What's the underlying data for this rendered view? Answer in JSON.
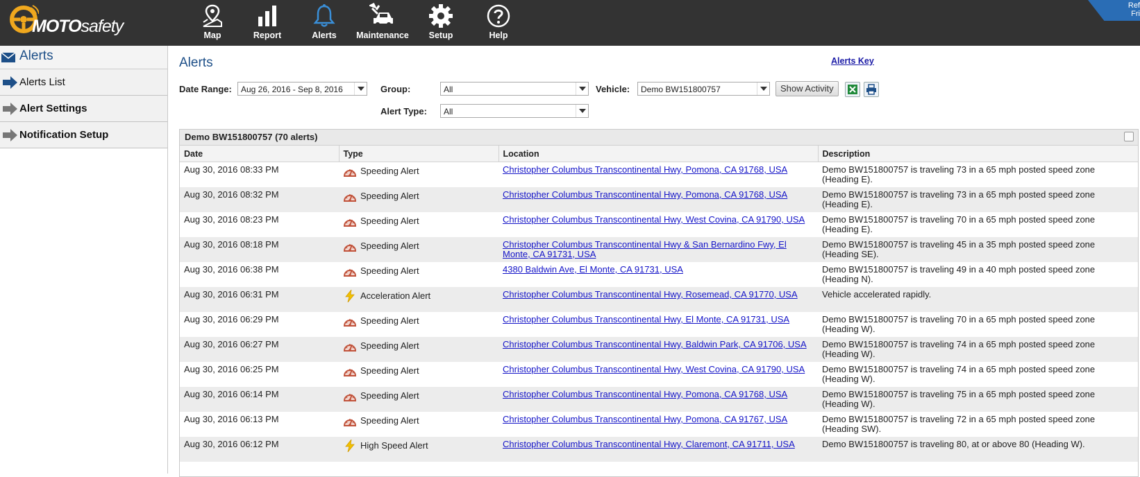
{
  "brand": {
    "logo_main": "MOTO",
    "logo_sub": "safety",
    "corner_text_1": "Ref",
    "corner_text_2": "Fri"
  },
  "nav": [
    {
      "label": "Map",
      "icon": "map-pin-icon"
    },
    {
      "label": "Report",
      "icon": "bar-chart-icon"
    },
    {
      "label": "Alerts",
      "icon": "bell-icon"
    },
    {
      "label": "Maintenance",
      "icon": "car-wrench-icon"
    },
    {
      "label": "Setup",
      "icon": "gear-icon"
    },
    {
      "label": "Help",
      "icon": "question-icon"
    }
  ],
  "sidebar": {
    "title": "Alerts",
    "items": [
      {
        "label": "Alerts List"
      },
      {
        "label": "Alert Settings"
      },
      {
        "label": "Notification Setup"
      }
    ]
  },
  "page": {
    "title": "Alerts",
    "alerts_key": "Alerts Key"
  },
  "filters": {
    "date_range_label": "Date Range:",
    "date_range_value": "Aug 26, 2016 - Sep 8, 2016",
    "group_label": "Group:",
    "group_value": "All",
    "vehicle_label": "Vehicle:",
    "vehicle_value": "Demo BW151800757",
    "show_activity": "Show Activity",
    "alert_type_label": "Alert Type:",
    "alert_type_value": "All"
  },
  "panel": {
    "title": "Demo BW151800757 (70 alerts)"
  },
  "table": {
    "headers": [
      "Date",
      "Type",
      "Location",
      "Description"
    ],
    "rows": [
      {
        "date": "Aug 30, 2016 08:33 PM",
        "type": "Speeding Alert",
        "kind": "speed",
        "location": "Christopher Columbus Transcontinental Hwy, Pomona, CA 91768, USA",
        "desc": "Demo BW151800757 is traveling 73 in a 65 mph posted speed zone (Heading E)."
      },
      {
        "date": "Aug 30, 2016 08:32 PM",
        "type": "Speeding Alert",
        "kind": "speed",
        "location": "Christopher Columbus Transcontinental Hwy, Pomona, CA 91768, USA",
        "desc": "Demo BW151800757 is traveling 73 in a 65 mph posted speed zone (Heading E)."
      },
      {
        "date": "Aug 30, 2016 08:23 PM",
        "type": "Speeding Alert",
        "kind": "speed",
        "location": "Christopher Columbus Transcontinental Hwy, West Covina, CA 91790, USA",
        "desc": "Demo BW151800757 is traveling 70 in a 65 mph posted speed zone (Heading E)."
      },
      {
        "date": "Aug 30, 2016 08:18 PM",
        "type": "Speeding Alert",
        "kind": "speed",
        "location": "Christopher Columbus Transcontinental Hwy & San Bernardino Fwy, El Monte, CA 91731, USA",
        "desc": "Demo BW151800757 is traveling 45 in a 35 mph posted speed zone (Heading SE)."
      },
      {
        "date": "Aug 30, 2016 06:38 PM",
        "type": "Speeding Alert",
        "kind": "speed",
        "location": "4380 Baldwin Ave, El Monte, CA 91731, USA",
        "desc": "Demo BW151800757 is traveling 49 in a 40 mph posted speed zone (Heading N)."
      },
      {
        "date": "Aug 30, 2016 06:31 PM",
        "type": "Acceleration Alert",
        "kind": "bolt",
        "location": "Christopher Columbus Transcontinental Hwy, Rosemead, CA 91770, USA",
        "desc": "Vehicle accelerated rapidly."
      },
      {
        "date": "Aug 30, 2016 06:29 PM",
        "type": "Speeding Alert",
        "kind": "speed",
        "location": "Christopher Columbus Transcontinental Hwy, El Monte, CA 91731, USA",
        "desc": "Demo BW151800757 is traveling 70 in a 65 mph posted speed zone (Heading W)."
      },
      {
        "date": "Aug 30, 2016 06:27 PM",
        "type": "Speeding Alert",
        "kind": "speed",
        "location": "Christopher Columbus Transcontinental Hwy, Baldwin Park, CA 91706, USA",
        "desc": "Demo BW151800757 is traveling 74 in a 65 mph posted speed zone (Heading W)."
      },
      {
        "date": "Aug 30, 2016 06:25 PM",
        "type": "Speeding Alert",
        "kind": "speed",
        "location": "Christopher Columbus Transcontinental Hwy, West Covina, CA 91790, USA",
        "desc": "Demo BW151800757 is traveling 74 in a 65 mph posted speed zone (Heading W)."
      },
      {
        "date": "Aug 30, 2016 06:14 PM",
        "type": "Speeding Alert",
        "kind": "speed",
        "location": "Christopher Columbus Transcontinental Hwy, Pomona, CA 91768, USA",
        "desc": "Demo BW151800757 is traveling 75 in a 65 mph posted speed zone (Heading W)."
      },
      {
        "date": "Aug 30, 2016 06:13 PM",
        "type": "Speeding Alert",
        "kind": "speed",
        "location": "Christopher Columbus Transcontinental Hwy, Pomona, CA 91767, USA",
        "desc": "Demo BW151800757 is traveling 72 in a 65 mph posted speed zone (Heading SW)."
      },
      {
        "date": "Aug 30, 2016 06:12 PM",
        "type": "High Speed Alert",
        "kind": "bolt",
        "location": "Christopher Columbus Transcontinental Hwy, Claremont, CA 91711, USA",
        "desc": "Demo BW151800757 is traveling 80, at or above 80 (Heading W)."
      }
    ]
  },
  "colors": {
    "topbar": "#333333",
    "title_blue": "#1d4f88",
    "link": "#1414c8",
    "speed_icon": "#c0523a",
    "bolt_icon": "#f2c200",
    "alerts_active": "#3a8fd8"
  }
}
